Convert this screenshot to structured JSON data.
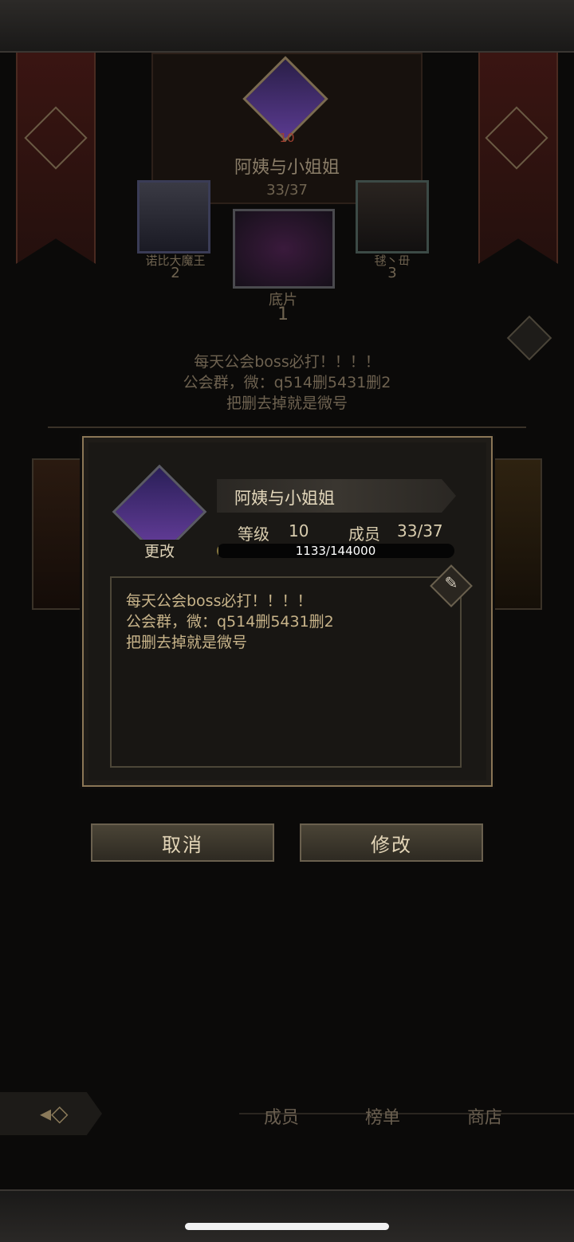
{
  "guild_bg": {
    "level": "10",
    "name": "阿姨与小姐姐",
    "members": "33/37",
    "ranks": [
      {
        "name": "诺比大魔王",
        "rank": "2"
      },
      {
        "name": "底片",
        "rank": "1"
      },
      {
        "name": "毬丶毌",
        "rank": "3"
      }
    ],
    "notice_lines": [
      "每天公会boss必打！！！！",
      "公会群，微：q514删5431删2",
      "把删去掉就是微号"
    ]
  },
  "dialog": {
    "guild_name": "阿姨与小姐姐",
    "change_label": "更改",
    "level_label": "等级",
    "level_value": "10",
    "members_label": "成员",
    "members_value": "33/37",
    "exp_text": "1133/144000",
    "exp_progress": 0.0079,
    "notice_lines": [
      "每天公会boss必打！！！！",
      "公会群，微：q514删5431删2",
      "把删去掉就是微号"
    ]
  },
  "buttons": {
    "cancel": "取消",
    "modify": "修改"
  },
  "bottom_nav": {
    "members": "成员",
    "ranking": "榜单",
    "shop": "商店"
  },
  "colors": {
    "gold": "#c9b894",
    "frame": "#8a7656",
    "banner": "#3a1512"
  }
}
